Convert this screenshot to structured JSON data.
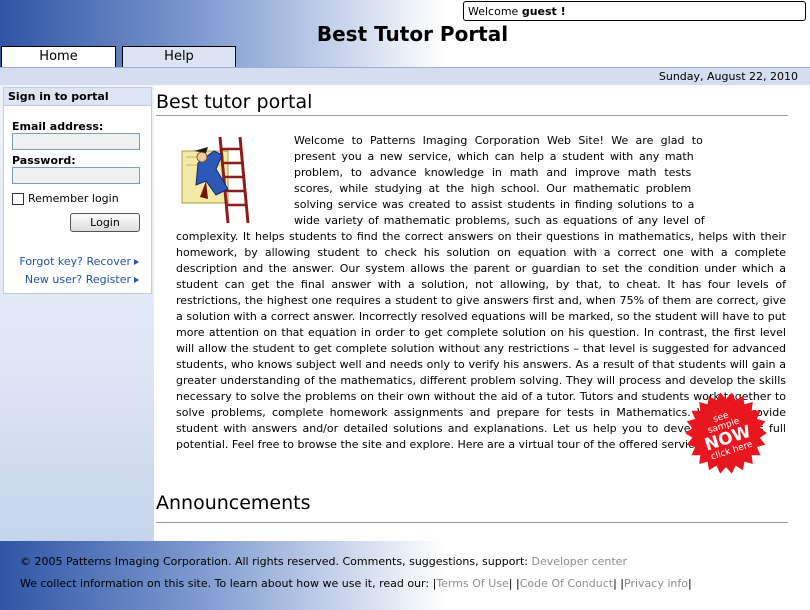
{
  "header": {
    "welcome_prefix": "Welcome ",
    "welcome_user": "guest !",
    "title": "Best Tutor Portal"
  },
  "tabs": [
    {
      "label": "Home",
      "active": true
    },
    {
      "label": "Help",
      "active": false
    }
  ],
  "date": "Sunday, August 22, 2010",
  "login": {
    "title": "Sign in to portal",
    "email_label": "Email address:",
    "email_value": "",
    "password_label": "Password:",
    "password_value": "",
    "remember_label": "Remember login",
    "remember_checked": false,
    "button_label": "Login",
    "forgot_link": "Forgot key? Recover",
    "register_link": "New user? Register"
  },
  "main": {
    "heading": "Best tutor portal",
    "intro": "Welcome to Patterns Imaging Corporation Web Site! We are glad to present you a new service, which can help a student with any math problem, to advance knowledge in math and improve math tests scores, while studying at the high school. Our mathematic problem solving service was created to assist students in finding solutions to a wide variety of mathematic problems, such as equations of any level of complexity. It helps students to find the correct answers on their questions in mathematics, helps with their homework, by allowing student to check his solution on equation with a correct one with a complete description and the answer. Our system allows the parent or guardian to set the condition under which a student can get the final answer with a solution, not allowing, by that, to cheat. It has four levels of restrictions, the highest one requires a student to give answers first and, when 75% of them are correct, give a solution with a correct answer. Incorrectly resolved equations will be marked, so the student will have to put more attention on that equation in order to get complete solution on his question. In contrast, the first level will allow the student to get complete solution without any restrictions – that level is suggested for advanced students, who knows subject well and needs only to verify his answers. As a result of that students will gain a greater understanding of the mathematics, different problem solving.  They will process and develop the skills necessary to solve the problems on their own without the aid of a tutor. Tutors and students work together to solve problems, complete homework assignments and prepare for tests in Mathematics. We will provide student with answers and/or detailed solutions and explanations. Let us help you to develop student’s full potential. Feel free to browse the site and explore. Here are a virtual tour of the offered service.",
    "badge_line1": "see",
    "badge_line2": "sample",
    "badge_line3": "NOW",
    "badge_line4": "click here",
    "badge_color": "#e8161f",
    "announcements_heading": "Announcements"
  },
  "footer": {
    "copyright": "© 2005 Patterns Imaging Corporation. All rights reserved. Comments, suggestions, support: ",
    "developer_link": "Developer center",
    "info_text": "We collect information on this site. To learn about how we use it, read our: ",
    "links": [
      "Terms Of Use",
      "Code Of Conduct",
      "Privacy info"
    ]
  },
  "colors": {
    "accent_blue": "#2f55a4",
    "link_blue": "#2651a6",
    "footer_link_gray": "#8d8d8d"
  }
}
